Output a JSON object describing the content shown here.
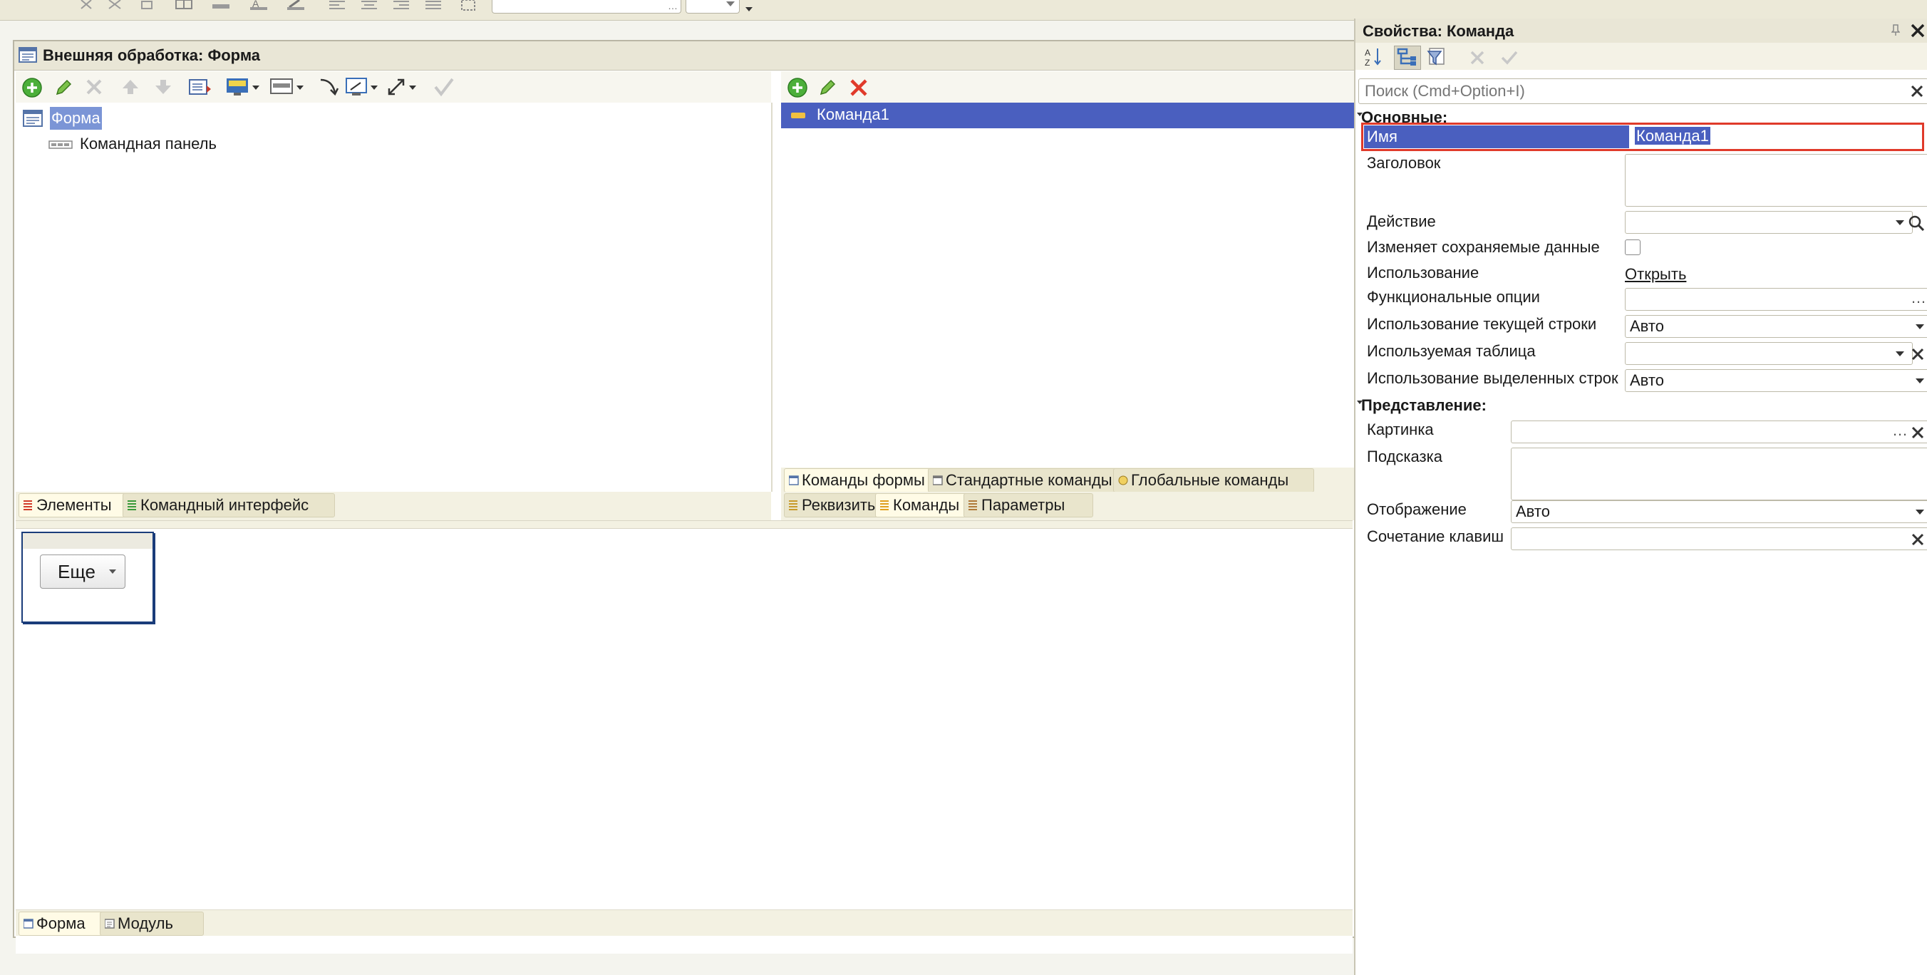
{
  "form_window": {
    "title": "Внешняя обработка: Форма"
  },
  "elements_tree": {
    "root": "Форма",
    "child": "Командная панель"
  },
  "left_tabs": [
    "Элементы",
    "Командный интерфейс"
  ],
  "commands_list": {
    "items": [
      "Команда1"
    ],
    "tabs_row1": [
      "Команды формы",
      "Стандартные команды",
      "Глобальные команды"
    ],
    "tabs_row2": [
      "Реквизиты",
      "Команды",
      "Параметры"
    ]
  },
  "preview": {
    "more_button": "Еще"
  },
  "bottom_tabs": [
    "Форма",
    "Модуль"
  ],
  "properties": {
    "title": "Свойства: Команда",
    "search_placeholder": "Поиск (Cmd+Option+I)",
    "section_main": "Основные:",
    "section_view": "Представление:",
    "name_label": "Имя",
    "name_value": "Команда1",
    "title_label": "Заголовок",
    "action_label": "Действие",
    "modifies_label": "Изменяет сохраняемые данные",
    "usage_label": "Использование",
    "usage_value": "Открыть",
    "func_options_label": "Функциональные опции",
    "current_row_label": "Использование текущей строки",
    "current_row_value": "Авто",
    "table_label": "Используемая таблица",
    "selected_rows_label": "Использование выделенных строк",
    "selected_rows_value": "Авто",
    "picture_label": "Картинка",
    "tooltip_label": "Подсказка",
    "display_label": "Отображение",
    "display_value": "Авто",
    "shortcut_label": "Сочетание клавиш"
  },
  "colors": {
    "selection": "#4a5fbf",
    "highlight_border": "#e03a2a",
    "tree_selection": "#7b95d6"
  }
}
